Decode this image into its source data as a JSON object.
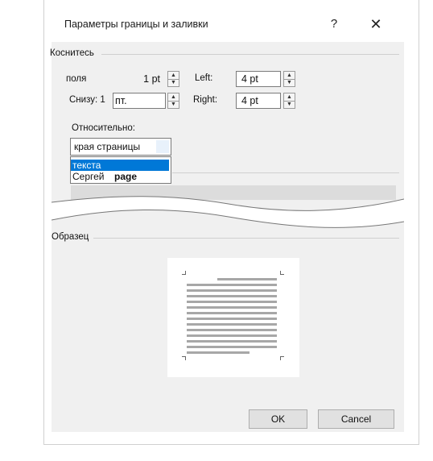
{
  "dialog": {
    "title": "Параметры границы и заливки",
    "help_label": "?",
    "close_label": "✕"
  },
  "margins": {
    "group_label": "Коснитесь",
    "top_label": "поля",
    "top_value": "1 pt",
    "left_label": "Left:",
    "left_value": "4 pt",
    "bottom_label": "Снизу: 1",
    "bottom_value": "пт.",
    "right_label": "Right:",
    "right_value": "4 pt",
    "measure_from_label": "Относительно:",
    "measure_from_value": "края страницы",
    "options": [
      "текста",
      "Сергей",
      "page"
    ]
  },
  "preview": {
    "group_label": "Образец"
  },
  "buttons": {
    "ok": "OK",
    "cancel": "Cancel"
  },
  "colors": {
    "accent": "#0078d7",
    "dialog_bg": "#f0f0f0"
  }
}
